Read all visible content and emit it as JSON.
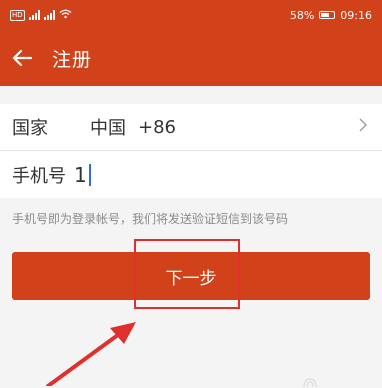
{
  "status": {
    "battery": "58%",
    "time": "09:16"
  },
  "header": {
    "title": "注册"
  },
  "form": {
    "country_label": "国家",
    "country_value": "中国",
    "country_code": "+86",
    "phone_label": "手机号",
    "phone_value": "1"
  },
  "hint": "手机号即为登录帐号，我们将发送验证短信到该号码",
  "next_button": "下一步",
  "colors": {
    "accent": "#d2421a",
    "annotation": "#e0302e",
    "cursor": "#2f6fd4"
  },
  "icons": [
    "back-arrow-icon",
    "chevron-right-icon",
    "battery-icon",
    "signal-icon",
    "wifi-icon"
  ]
}
